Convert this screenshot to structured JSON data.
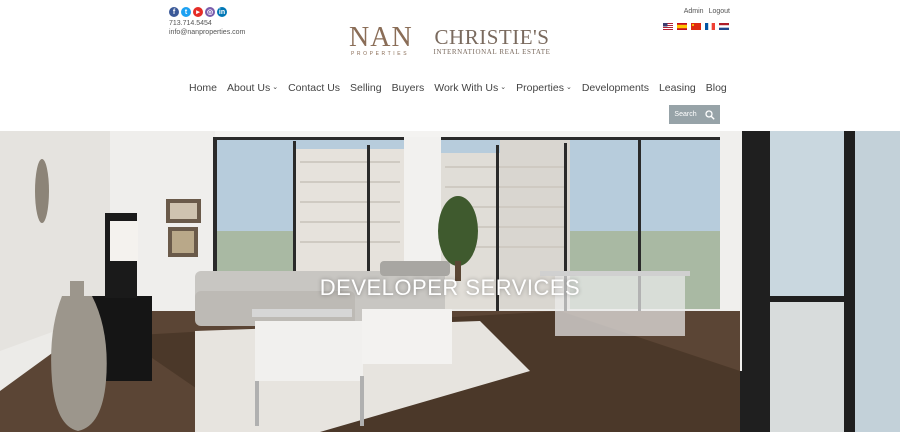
{
  "header": {
    "social_icons": [
      {
        "name": "facebook-icon",
        "glyph": "f"
      },
      {
        "name": "twitter-icon",
        "glyph": "t"
      },
      {
        "name": "youtube-icon",
        "glyph": "▸"
      },
      {
        "name": "instagram-icon",
        "glyph": "◎"
      },
      {
        "name": "linkedin-icon",
        "glyph": "in"
      }
    ],
    "phone": "713.714.5454",
    "email": "info@nanproperties.com",
    "logo_nan": {
      "word": "NAN",
      "sub": "PROPERTIES"
    },
    "logo_christies": {
      "word": "CHRISTIE'S",
      "sub": "INTERNATIONAL REAL ESTATE"
    },
    "admin_link": "Admin",
    "logout_link": "Logout",
    "flags": [
      "us-flag-icon",
      "es-flag-icon",
      "cn-flag-icon",
      "fr-flag-icon",
      "nl-flag-icon"
    ]
  },
  "nav": {
    "items": [
      {
        "label": "Home",
        "dropdown": false
      },
      {
        "label": "About Us",
        "dropdown": true
      },
      {
        "label": "Contact Us",
        "dropdown": false
      },
      {
        "label": "Selling",
        "dropdown": false
      },
      {
        "label": "Buyers",
        "dropdown": false
      },
      {
        "label": "Work With Us",
        "dropdown": true
      },
      {
        "label": "Properties",
        "dropdown": true
      },
      {
        "label": "Developments",
        "dropdown": false
      },
      {
        "label": "Leasing",
        "dropdown": false
      },
      {
        "label": "Blog",
        "dropdown": false
      }
    ],
    "search_label": "Search"
  },
  "hero": {
    "title": "DEVELOPER SERVICES"
  },
  "colors": {
    "brand": "#8a6d57",
    "search_button": "#97a3a8",
    "nav_text": "#444444"
  }
}
